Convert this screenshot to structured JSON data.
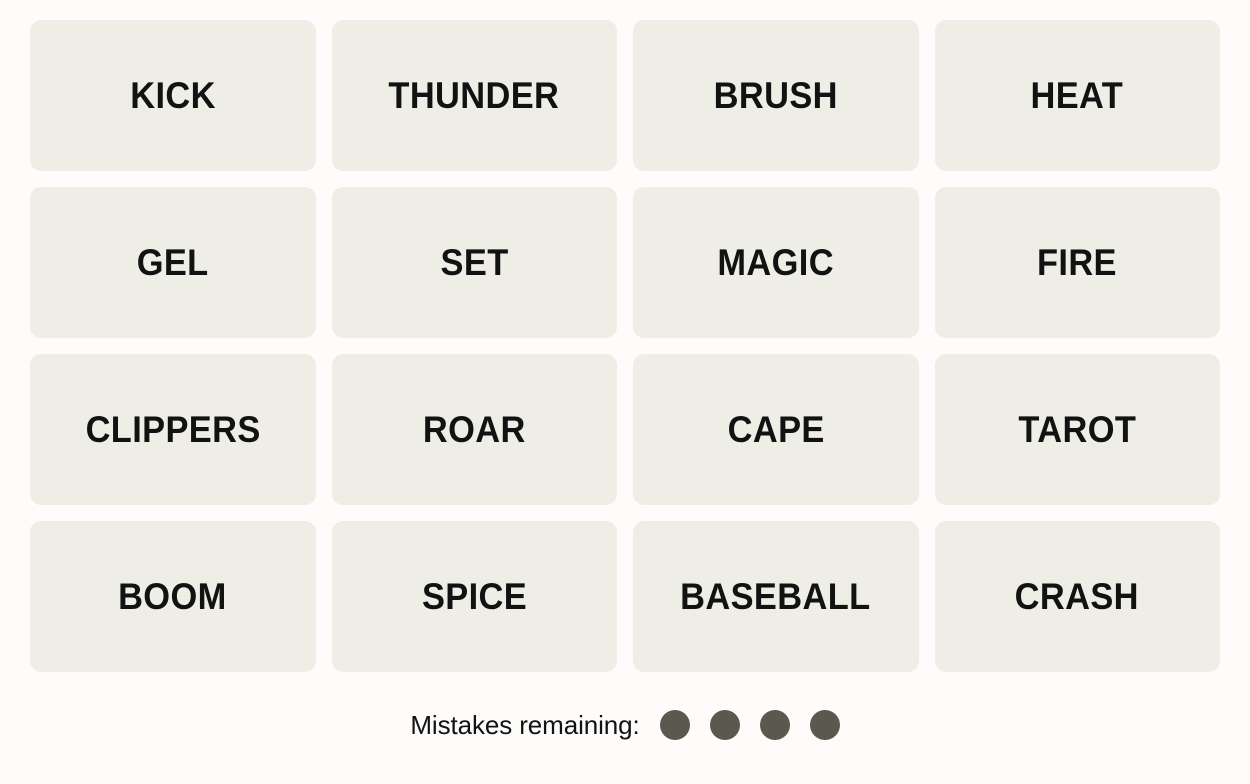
{
  "game": {
    "name": "Connections",
    "colors": {
      "page_background": "#FDFCFA",
      "tile_background": "#EFEEE6",
      "tile_text": "#121212",
      "mistake_dot": "#5A594E"
    }
  },
  "board": {
    "rows": 4,
    "columns": 4,
    "tiles": [
      {
        "label": "KICK"
      },
      {
        "label": "THUNDER"
      },
      {
        "label": "BRUSH"
      },
      {
        "label": "HEAT"
      },
      {
        "label": "GEL"
      },
      {
        "label": "SET"
      },
      {
        "label": "MAGIC"
      },
      {
        "label": "FIRE"
      },
      {
        "label": "CLIPPERS"
      },
      {
        "label": "ROAR"
      },
      {
        "label": "CAPE"
      },
      {
        "label": "TAROT"
      },
      {
        "label": "BOOM"
      },
      {
        "label": "SPICE"
      },
      {
        "label": "BASEBALL"
      },
      {
        "label": "CRASH"
      }
    ]
  },
  "mistakes": {
    "label": "Mistakes remaining:",
    "remaining": 4,
    "dots": [
      {
        "state": "filled"
      },
      {
        "state": "filled"
      },
      {
        "state": "filled"
      },
      {
        "state": "filled"
      }
    ]
  }
}
